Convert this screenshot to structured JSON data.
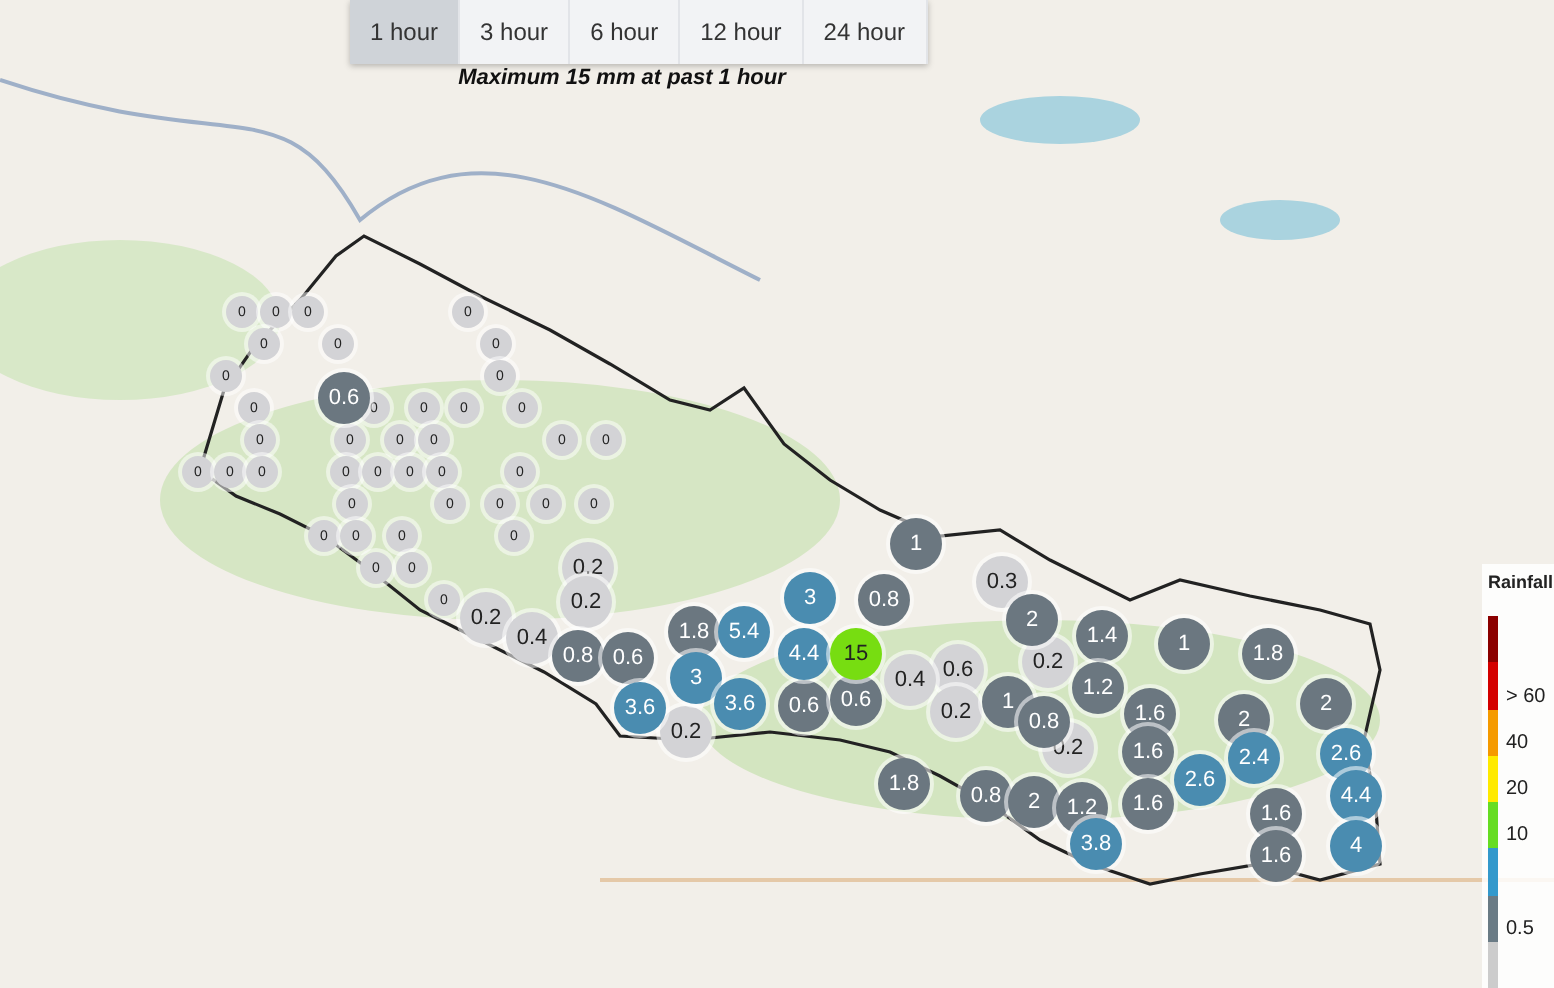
{
  "tabs": [
    {
      "label": "1 hour",
      "selected": true
    },
    {
      "label": "3 hour",
      "selected": false
    },
    {
      "label": "6 hour",
      "selected": false
    },
    {
      "label": "12 hour",
      "selected": false
    },
    {
      "label": "24 hour",
      "selected": false
    }
  ],
  "caption": "Maximum 15 mm at past 1 hour",
  "station_dots": [
    {
      "value": "0"
    },
    {
      "value": "0"
    },
    {
      "value": "0"
    },
    {
      "value": "0"
    },
    {
      "value": "0"
    },
    {
      "value": "0"
    },
    {
      "value": "0"
    },
    {
      "value": "0"
    },
    {
      "value": "0"
    },
    {
      "value": "0"
    },
    {
      "value": "0"
    },
    {
      "value": "0"
    },
    {
      "value": "0"
    },
    {
      "value": "0"
    },
    {
      "value": "0"
    },
    {
      "value": "0"
    },
    {
      "value": "0"
    },
    {
      "value": "0"
    },
    {
      "value": "0"
    },
    {
      "value": "0"
    },
    {
      "value": "0"
    },
    {
      "value": "0"
    },
    {
      "value": "0"
    },
    {
      "value": "0"
    },
    {
      "value": "0"
    },
    {
      "value": "0"
    },
    {
      "value": "0"
    },
    {
      "value": "0"
    },
    {
      "value": "0"
    },
    {
      "value": "0"
    },
    {
      "value": "0"
    },
    {
      "value": "0"
    },
    {
      "value": "0"
    },
    {
      "value": "0"
    },
    {
      "value": "0"
    },
    {
      "value": "0"
    },
    {
      "value": "0"
    },
    {
      "value": "0"
    },
    {
      "value": "0"
    },
    {
      "value": "0"
    }
  ],
  "rain_markers": [
    {
      "value": "0.6",
      "color": "#6b7780"
    },
    {
      "value": "0.2",
      "color": "#d3d3d6"
    },
    {
      "value": "0.2",
      "color": "#d3d3d6"
    },
    {
      "value": "3",
      "color": "#4a8cb0"
    },
    {
      "value": "1",
      "color": "#6b7780"
    },
    {
      "value": "0.2",
      "color": "#d3d3d6"
    },
    {
      "value": "0.4",
      "color": "#d3d3d6"
    },
    {
      "value": "0.8",
      "color": "#6b7780"
    },
    {
      "value": "0.6",
      "color": "#6b7780"
    },
    {
      "value": "1.8",
      "color": "#6b7780"
    },
    {
      "value": "5.4",
      "color": "#4a8cb0"
    },
    {
      "value": "4.4",
      "color": "#4a8cb0"
    },
    {
      "value": "0.8",
      "color": "#6b7780"
    },
    {
      "value": "15",
      "color": "#77dd11"
    },
    {
      "value": "0.3",
      "color": "#d3d3d6"
    },
    {
      "value": "0.6",
      "color": "#d3d3d6"
    },
    {
      "value": "2",
      "color": "#6b7780"
    },
    {
      "value": "0.2",
      "color": "#d3d3d6"
    },
    {
      "value": "1.4",
      "color": "#6b7780"
    },
    {
      "value": "1",
      "color": "#6b7780"
    },
    {
      "value": "1.8",
      "color": "#6b7780"
    },
    {
      "value": "3.6",
      "color": "#4a8cb0"
    },
    {
      "value": "3",
      "color": "#4a8cb0"
    },
    {
      "value": "0.2",
      "color": "#d3d3d6"
    },
    {
      "value": "3.6",
      "color": "#4a8cb0"
    },
    {
      "value": "0.6",
      "color": "#6b7780"
    },
    {
      "value": "0.6",
      "color": "#6b7780"
    },
    {
      "value": "0.4",
      "color": "#d3d3d6"
    },
    {
      "value": "0.2",
      "color": "#d3d3d6"
    },
    {
      "value": "1",
      "color": "#6b7780"
    },
    {
      "value": "0.8",
      "color": "#6b7780"
    },
    {
      "value": "1.2",
      "color": "#6b7780"
    },
    {
      "value": "1.6",
      "color": "#6b7780"
    },
    {
      "value": "2",
      "color": "#6b7780"
    },
    {
      "value": "2",
      "color": "#6b7780"
    },
    {
      "value": "1.8",
      "color": "#6b7780"
    },
    {
      "value": "0.8",
      "color": "#6b7780"
    },
    {
      "value": "0.2",
      "color": "#d3d3d6"
    },
    {
      "value": "2",
      "color": "#6b7780"
    },
    {
      "value": "1.2",
      "color": "#6b7780"
    },
    {
      "value": "3.8",
      "color": "#4a8cb0"
    },
    {
      "value": "1.6",
      "color": "#6b7780"
    },
    {
      "value": "1.6",
      "color": "#6b7780"
    },
    {
      "value": "2.6",
      "color": "#4a8cb0"
    },
    {
      "value": "2.4",
      "color": "#4a8cb0"
    },
    {
      "value": "1.6",
      "color": "#6b7780"
    },
    {
      "value": "1.6",
      "color": "#6b7780"
    },
    {
      "value": "2.6",
      "color": "#4a8cb0"
    },
    {
      "value": "4.4",
      "color": "#4a8cb0"
    },
    {
      "value": "4",
      "color": "#4a8cb0"
    }
  ],
  "legend": {
    "title": "Rainfall",
    "bands": [
      {
        "color": "#8b0000"
      },
      {
        "color": "#d40000",
        "label": "> 60"
      },
      {
        "color": "#f59a00",
        "label": "40"
      },
      {
        "color": "#ffea00",
        "label": "20"
      },
      {
        "color": "#66dd22",
        "label": "10"
      },
      {
        "color": "#3399cc"
      },
      {
        "color": "#6a7b85",
        "label": "0.5"
      },
      {
        "color": "#cccccc"
      }
    ]
  }
}
